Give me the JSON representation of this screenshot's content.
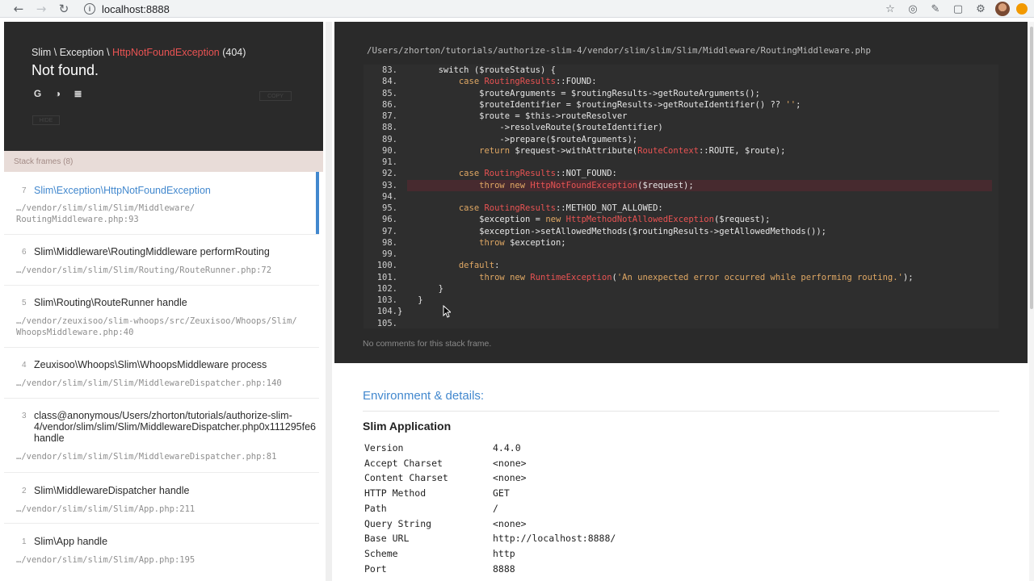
{
  "browser": {
    "url": "localhost:8888",
    "back_icon": "←",
    "forward_icon": "→",
    "reload_icon": "↻"
  },
  "exception": {
    "class_prefix": "Slim \\ Exception \\ ",
    "class_name": "HttpNotFoundException",
    "code": " (404)",
    "message": "Not found.",
    "copy_label": "COPY",
    "hide_label": "HIDE"
  },
  "frames_header": "Stack frames (8)",
  "frames": [
    {
      "index": "7",
      "class": "Slim\\Exception\\HttpNotFoundException",
      "file": "…/vendor/slim/slim/Slim/Middleware/\nRoutingMiddleware.php:93"
    },
    {
      "index": "6",
      "class": "Slim\\Middleware\\RoutingMiddleware performRouting",
      "file": "…/vendor/slim/slim/Slim/Routing/RouteRunner.php:72"
    },
    {
      "index": "5",
      "class": "Slim\\Routing\\RouteRunner handle",
      "file": "…/vendor/zeuxisoo/slim-whoops/src/Zeuxisoo/Whoops/Slim/\nWhoopsMiddleware.php:40"
    },
    {
      "index": "4",
      "class": "Zeuxisoo\\Whoops\\Slim\\WhoopsMiddleware process",
      "file": "…/vendor/slim/slim/Slim/MiddlewareDispatcher.php:140"
    },
    {
      "index": "3",
      "class": "class@anonymous/Users/zhorton/tutorials/authorize-slim-\n4/vendor/slim/slim/Slim/MiddlewareDispatcher.php0x111295fe6\nhandle",
      "file": "…/vendor/slim/slim/Slim/MiddlewareDispatcher.php:81"
    },
    {
      "index": "2",
      "class": "Slim\\MiddlewareDispatcher handle",
      "file": "…/vendor/slim/slim/Slim/App.php:211"
    },
    {
      "index": "1",
      "class": "Slim\\App handle",
      "file": "…/vendor/slim/slim/Slim/App.php:195"
    }
  ],
  "code": {
    "path": "/Users/zhorton/tutorials/authorize-slim-4/vendor/slim/slim/Slim/Middleware/RoutingMiddleware.php",
    "highlighted_line": "93",
    "lines": [
      {
        "n": "83.",
        "parts": [
          [
            "t",
            "        switch ($routeStatus) {"
          ]
        ]
      },
      {
        "n": "84.",
        "parts": [
          [
            "k",
            "            case "
          ],
          [
            "c",
            "RoutingResults"
          ],
          [
            "t",
            "::FOUND:"
          ]
        ]
      },
      {
        "n": "85.",
        "parts": [
          [
            "t",
            "                $routeArguments = $routingResults->getRouteArguments();"
          ]
        ]
      },
      {
        "n": "86.",
        "parts": [
          [
            "t",
            "                $routeIdentifier = $routingResults->getRouteIdentifier() ?? "
          ],
          [
            "s",
            "''"
          ],
          [
            "t",
            ";"
          ]
        ]
      },
      {
        "n": "87.",
        "parts": [
          [
            "t",
            "                $route = $this->routeResolver"
          ]
        ]
      },
      {
        "n": "88.",
        "parts": [
          [
            "t",
            "                    ->resolveRoute($routeIdentifier)"
          ]
        ]
      },
      {
        "n": "89.",
        "parts": [
          [
            "t",
            "                    ->prepare($routeArguments);"
          ]
        ]
      },
      {
        "n": "90.",
        "parts": [
          [
            "k",
            "                return "
          ],
          [
            "t",
            "$request->withAttribute("
          ],
          [
            "c",
            "RouteContext"
          ],
          [
            "t",
            "::ROUTE, $route);"
          ]
        ]
      },
      {
        "n": "91.",
        "parts": [
          [
            "t",
            ""
          ]
        ]
      },
      {
        "n": "92.",
        "parts": [
          [
            "k",
            "            case "
          ],
          [
            "c",
            "RoutingResults"
          ],
          [
            "t",
            "::NOT_FOUND:"
          ]
        ]
      },
      {
        "n": "93.",
        "parts": [
          [
            "k",
            "                throw new "
          ],
          [
            "c",
            "HttpNotFoundException"
          ],
          [
            "t",
            "($request);"
          ]
        ]
      },
      {
        "n": "94.",
        "parts": [
          [
            "t",
            ""
          ]
        ]
      },
      {
        "n": "95.",
        "parts": [
          [
            "k",
            "            case "
          ],
          [
            "c",
            "RoutingResults"
          ],
          [
            "t",
            "::METHOD_NOT_ALLOWED:"
          ]
        ]
      },
      {
        "n": "96.",
        "parts": [
          [
            "t",
            "                $exception = "
          ],
          [
            "k",
            "new "
          ],
          [
            "c",
            "HttpMethodNotAllowedException"
          ],
          [
            "t",
            "($request);"
          ]
        ]
      },
      {
        "n": "97.",
        "parts": [
          [
            "t",
            "                $exception->setAllowedMethods($routingResults->getAllowedMethods());"
          ]
        ]
      },
      {
        "n": "98.",
        "parts": [
          [
            "k",
            "                throw "
          ],
          [
            "t",
            "$exception;"
          ]
        ]
      },
      {
        "n": "99.",
        "parts": [
          [
            "t",
            ""
          ]
        ]
      },
      {
        "n": "100.",
        "parts": [
          [
            "k",
            "            default"
          ],
          [
            "t",
            ":"
          ]
        ]
      },
      {
        "n": "101.",
        "parts": [
          [
            "k",
            "                throw new "
          ],
          [
            "c",
            "RuntimeException"
          ],
          [
            "t",
            "("
          ],
          [
            "s",
            "'An unexpected error occurred while performing routing.'"
          ],
          [
            "t",
            ");"
          ]
        ]
      },
      {
        "n": "102.",
        "parts": [
          [
            "t",
            "        }"
          ]
        ]
      },
      {
        "n": "103.",
        "parts": [
          [
            "t",
            "    }"
          ]
        ]
      },
      {
        "n": "104.",
        "parts": [
          [
            "t",
            "}"
          ]
        ]
      },
      {
        "n": "105.",
        "parts": [
          [
            "t",
            ""
          ]
        ]
      }
    ],
    "comments_text": "No comments for this stack frame."
  },
  "details": {
    "env_title": "Environment & details:",
    "app_title": "Slim Application",
    "rows": [
      {
        "key": "Version",
        "value": "4.4.0"
      },
      {
        "key": "Accept Charset",
        "value": "<none>"
      },
      {
        "key": "Content Charset",
        "value": "<none>"
      },
      {
        "key": "HTTP Method",
        "value": "GET"
      },
      {
        "key": "Path",
        "value": "/"
      },
      {
        "key": "Query String",
        "value": "<none>"
      },
      {
        "key": "Base URL",
        "value": "http://localhost:8888/"
      },
      {
        "key": "Scheme",
        "value": "http"
      },
      {
        "key": "Port",
        "value": "8888"
      }
    ]
  }
}
